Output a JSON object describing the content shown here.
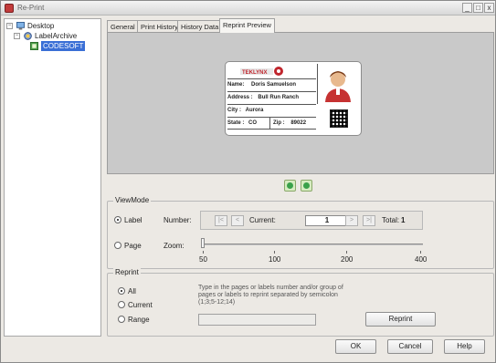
{
  "window": {
    "title": "Re-Print",
    "minimize": "_",
    "maximize": "□",
    "close": "x"
  },
  "tree": {
    "root": "Desktop",
    "child": "LabelArchive",
    "leaf": "CODESOFT"
  },
  "tabs": [
    "General",
    "Print History",
    "History Data",
    "Reprint Preview"
  ],
  "label_card": {
    "logo": "TEKLYNX",
    "name_label": "Name:",
    "name_value": "Doris Samuelson",
    "address_label": "Address :",
    "address_value": "Bull Run Ranch",
    "city_label": "City :",
    "city_value": "Aurora",
    "state_label": "State :",
    "state_value": "CO",
    "zip_label": "Zip :",
    "zip_value": "89022"
  },
  "viewmode": {
    "title": "ViewMode",
    "label_option": "Label",
    "page_option": "Page",
    "number_label": "Number:",
    "current_label": "Current:",
    "current_value": "1",
    "total_label": "Total:",
    "total_value": "1",
    "first_btn": "|<",
    "prev_btn": "<",
    "next_btn": ">",
    "last_btn": ">|",
    "zoom_label": "Zoom:",
    "zoom_value": 50,
    "zoom_ticks": [
      "50",
      "100",
      "200",
      "400"
    ]
  },
  "reprint": {
    "title": "Reprint",
    "all_option": "All",
    "current_option": "Current",
    "range_option": "Range",
    "hint": "Type in the pages or labels number and/or group of pages or labels to reprint separated by semicolon (1;3;5-12;14)",
    "range_value": "",
    "reprint_button": "Reprint"
  },
  "footer": {
    "ok": "OK",
    "cancel": "Cancel",
    "help": "Help"
  }
}
